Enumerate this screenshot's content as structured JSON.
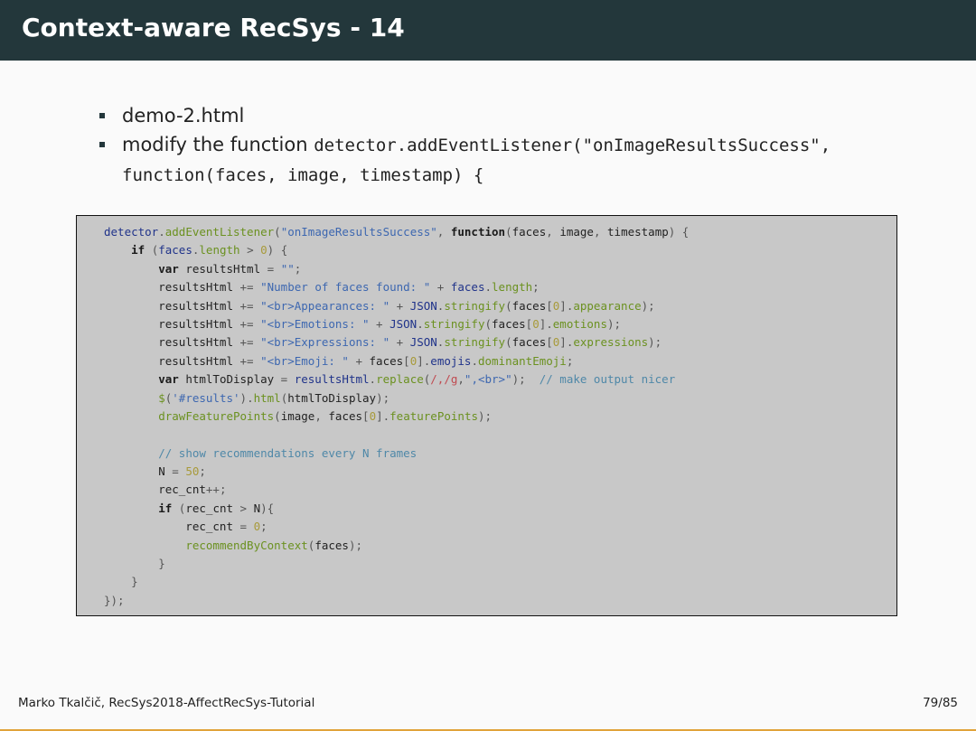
{
  "slide": {
    "title": "Context-aware RecSys - 14",
    "bullets": [
      {
        "text": "demo-2.html"
      },
      {
        "prefix": "modify the function ",
        "code_line1": "detector.addEventListener(\"onImageResultsSuccess\",",
        "code_line2": "function(faces, image, timestamp) {"
      }
    ]
  },
  "code": {
    "lines": [
      [
        [
          "obj",
          "detector"
        ],
        [
          "op",
          "."
        ],
        [
          "fn",
          "addEventListener"
        ],
        [
          "op",
          "("
        ],
        [
          "str",
          "\"onImageResultsSuccess\""
        ],
        [
          "op",
          ", "
        ],
        [
          "kw",
          "function"
        ],
        [
          "op",
          "("
        ],
        [
          "",
          "faces"
        ],
        [
          "op",
          ", "
        ],
        [
          "",
          "image"
        ],
        [
          "op",
          ", "
        ],
        [
          "",
          "timestamp"
        ],
        [
          "op",
          ") {"
        ]
      ],
      [
        [
          "",
          "    "
        ],
        [
          "kw",
          "if"
        ],
        [
          "op",
          " ("
        ],
        [
          "obj",
          "faces"
        ],
        [
          "op",
          "."
        ],
        [
          "fn",
          "length"
        ],
        [
          "op",
          " > "
        ],
        [
          "num",
          "0"
        ],
        [
          "op",
          ") {"
        ]
      ],
      [
        [
          "",
          "        "
        ],
        [
          "kw",
          "var"
        ],
        [
          "",
          ""
        ],
        [
          "",
          " resultsHtml"
        ],
        [
          "op",
          " = "
        ],
        [
          "str",
          "\"\""
        ],
        [
          "op",
          ";"
        ]
      ],
      [
        [
          "",
          "        resultsHtml"
        ],
        [
          "op",
          " += "
        ],
        [
          "str",
          "\"Number of faces found: \""
        ],
        [
          "op",
          " + "
        ],
        [
          "obj",
          "faces"
        ],
        [
          "op",
          "."
        ],
        [
          "fn",
          "length"
        ],
        [
          "op",
          ";"
        ]
      ],
      [
        [
          "",
          "        resultsHtml"
        ],
        [
          "op",
          " += "
        ],
        [
          "str",
          "\"<br>Appearances: \""
        ],
        [
          "op",
          " + "
        ],
        [
          "obj",
          "JSON"
        ],
        [
          "op",
          "."
        ],
        [
          "fn",
          "stringify"
        ],
        [
          "op",
          "("
        ],
        [
          "",
          "faces"
        ],
        [
          "op",
          "["
        ],
        [
          "num",
          "0"
        ],
        [
          "op",
          "]."
        ],
        [
          "fn",
          "appearance"
        ],
        [
          "op",
          ");"
        ]
      ],
      [
        [
          "",
          "        resultsHtml"
        ],
        [
          "op",
          " += "
        ],
        [
          "str",
          "\"<br>Emotions: \""
        ],
        [
          "op",
          " + "
        ],
        [
          "obj",
          "JSON"
        ],
        [
          "op",
          "."
        ],
        [
          "fn",
          "stringify"
        ],
        [
          "op",
          "("
        ],
        [
          "",
          "faces"
        ],
        [
          "op",
          "["
        ],
        [
          "num",
          "0"
        ],
        [
          "op",
          "]."
        ],
        [
          "fn",
          "emotions"
        ],
        [
          "op",
          ");"
        ]
      ],
      [
        [
          "",
          "        resultsHtml"
        ],
        [
          "op",
          " += "
        ],
        [
          "str",
          "\"<br>Expressions: \""
        ],
        [
          "op",
          " + "
        ],
        [
          "obj",
          "JSON"
        ],
        [
          "op",
          "."
        ],
        [
          "fn",
          "stringify"
        ],
        [
          "op",
          "("
        ],
        [
          "",
          "faces"
        ],
        [
          "op",
          "["
        ],
        [
          "num",
          "0"
        ],
        [
          "op",
          "]."
        ],
        [
          "fn",
          "expressions"
        ],
        [
          "op",
          ");"
        ]
      ],
      [
        [
          "",
          "        resultsHtml"
        ],
        [
          "op",
          " += "
        ],
        [
          "str",
          "\"<br>Emoji: \""
        ],
        [
          "op",
          " + "
        ],
        [
          "",
          "faces"
        ],
        [
          "op",
          "["
        ],
        [
          "num",
          "0"
        ],
        [
          "op",
          "]."
        ],
        [
          "obj",
          "emojis"
        ],
        [
          "op",
          "."
        ],
        [
          "fn",
          "dominantEmoji"
        ],
        [
          "op",
          ";"
        ]
      ],
      [
        [
          "",
          "        "
        ],
        [
          "kw",
          "var"
        ],
        [
          "",
          " htmlToDisplay"
        ],
        [
          "op",
          " = "
        ],
        [
          "obj",
          "resultsHtml"
        ],
        [
          "op",
          "."
        ],
        [
          "fn",
          "replace"
        ],
        [
          "op",
          "("
        ],
        [
          "reg",
          "/,/g"
        ],
        [
          "op",
          ","
        ],
        [
          "str",
          "\",<br>\""
        ],
        [
          "op",
          ");  "
        ],
        [
          "cmt",
          "// make output nicer"
        ]
      ],
      [
        [
          "",
          "        "
        ],
        [
          "fn",
          "$"
        ],
        [
          "op",
          "("
        ],
        [
          "str",
          "'#results'"
        ],
        [
          "op",
          ")."
        ],
        [
          "fn",
          "html"
        ],
        [
          "op",
          "("
        ],
        [
          "",
          "htmlToDisplay"
        ],
        [
          "op",
          ");"
        ]
      ],
      [
        [
          "",
          "        "
        ],
        [
          "fn",
          "drawFeaturePoints"
        ],
        [
          "op",
          "("
        ],
        [
          "",
          "image"
        ],
        [
          "op",
          ", "
        ],
        [
          "",
          "faces"
        ],
        [
          "op",
          "["
        ],
        [
          "num",
          "0"
        ],
        [
          "op",
          "]."
        ],
        [
          "fn",
          "featurePoints"
        ],
        [
          "op",
          ");"
        ]
      ],
      [
        [
          "",
          ""
        ]
      ],
      [
        [
          "",
          "        "
        ],
        [
          "cmt",
          "// show recommendations every N frames"
        ]
      ],
      [
        [
          "",
          "        N"
        ],
        [
          "op",
          " = "
        ],
        [
          "num",
          "50"
        ],
        [
          "op",
          ";"
        ]
      ],
      [
        [
          "",
          "        rec_cnt"
        ],
        [
          "op",
          "++;"
        ]
      ],
      [
        [
          "",
          "        "
        ],
        [
          "kw",
          "if"
        ],
        [
          "op",
          " ("
        ],
        [
          "",
          "rec_cnt"
        ],
        [
          "op",
          " > "
        ],
        [
          "",
          "N"
        ],
        [
          "op",
          "){"
        ]
      ],
      [
        [
          "",
          "            rec_cnt"
        ],
        [
          "op",
          " = "
        ],
        [
          "num",
          "0"
        ],
        [
          "op",
          ";"
        ]
      ],
      [
        [
          "",
          "            "
        ],
        [
          "fn",
          "recommendByContext"
        ],
        [
          "op",
          "("
        ],
        [
          "",
          "faces"
        ],
        [
          "op",
          ");"
        ]
      ],
      [
        [
          "",
          "        "
        ],
        [
          "op",
          "}"
        ]
      ],
      [
        [
          "",
          "    "
        ],
        [
          "op",
          "}"
        ]
      ],
      [
        [
          "op",
          "});"
        ]
      ]
    ]
  },
  "footer": {
    "author": "Marko Tkalčič, RecSys2018-AffectRecSys-Tutorial",
    "page": "79/85"
  },
  "colors": {
    "header_bg": "#23373b",
    "accent_rule": "#e1a33a",
    "code_bg": "#c8c8c8"
  }
}
